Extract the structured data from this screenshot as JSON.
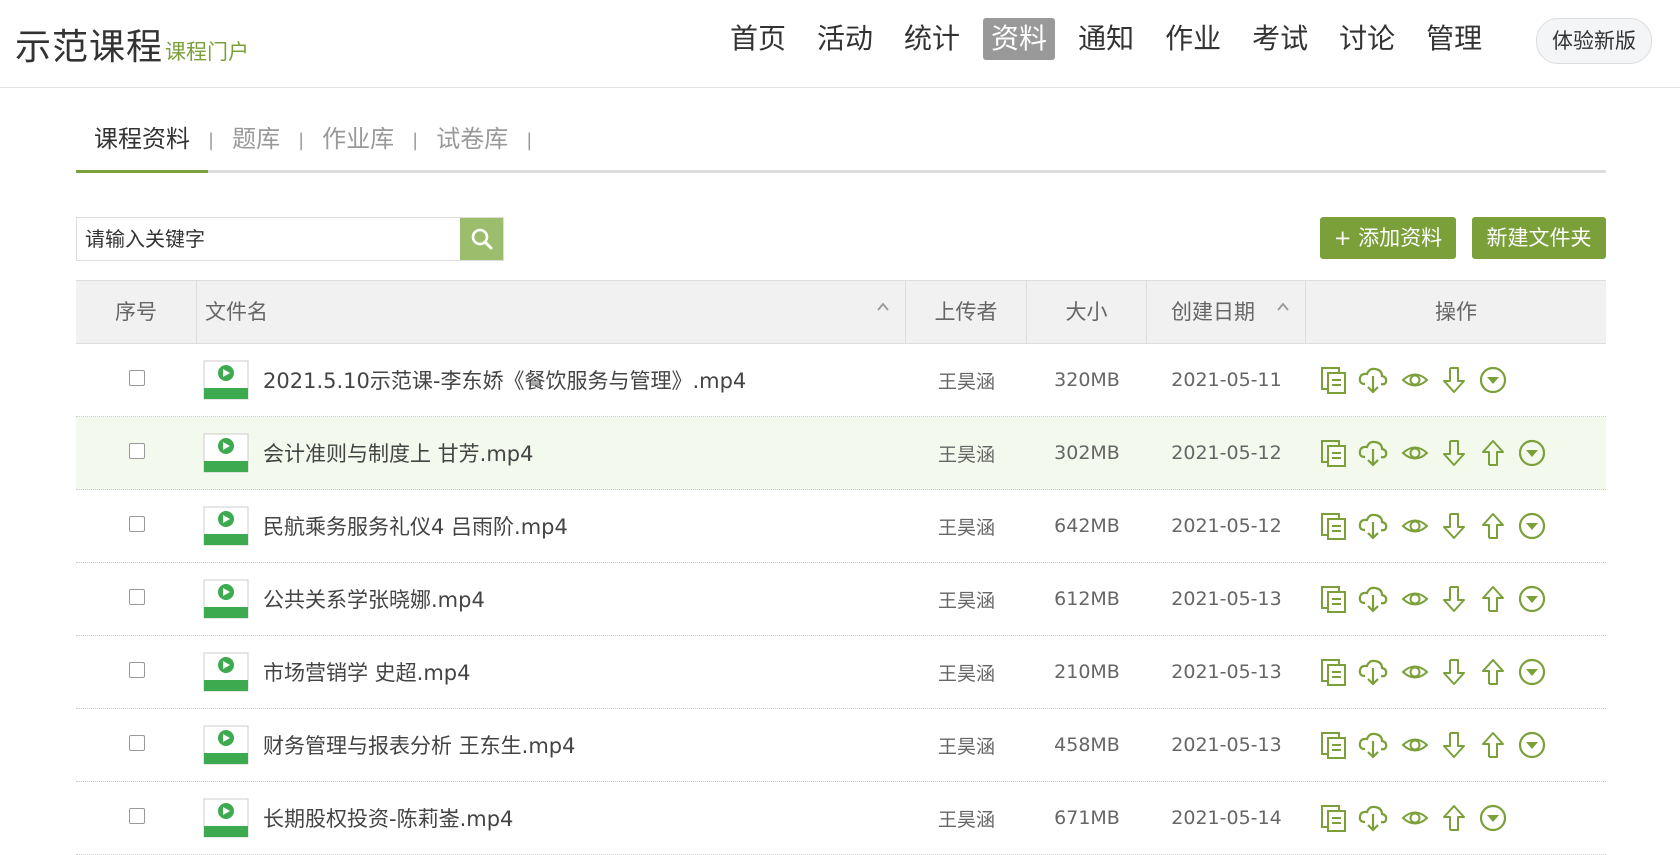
{
  "header": {
    "title": "示范课程",
    "subtitle": "课程门户",
    "nav": [
      "首页",
      "活动",
      "统计",
      "资料",
      "通知",
      "作业",
      "考试",
      "讨论",
      "管理"
    ],
    "active_nav": "资料",
    "try_new": "体验新版"
  },
  "subtabs": [
    "课程资料",
    "题库",
    "作业库",
    "试卷库"
  ],
  "search": {
    "placeholder": "请输入关键字"
  },
  "buttons": {
    "add": "+ 添加资料",
    "new_folder": "新建文件夹"
  },
  "table": {
    "headers": {
      "num": "序号",
      "name": "文件名",
      "uploader": "上传者",
      "size": "大小",
      "date": "创建日期",
      "ops": "操作"
    },
    "rows": [
      {
        "name": "2021.5.10示范课-李东娇《餐饮服务与管理》.mp4",
        "uploader": "王昊涵",
        "size": "320MB",
        "date": "2021-05-11",
        "ops": [
          "copy",
          "cloud",
          "view",
          "down",
          "menu"
        ]
      },
      {
        "name": "会计准则与制度上 甘芳.mp4",
        "uploader": "王昊涵",
        "size": "302MB",
        "date": "2021-05-12",
        "ops": [
          "copy",
          "cloud",
          "view",
          "down",
          "up",
          "menu"
        ]
      },
      {
        "name": "民航乘务服务礼仪4 吕雨阶.mp4",
        "uploader": "王昊涵",
        "size": "642MB",
        "date": "2021-05-12",
        "ops": [
          "copy",
          "cloud",
          "view",
          "down",
          "up",
          "menu"
        ]
      },
      {
        "name": "公共关系学张晓娜.mp4",
        "uploader": "王昊涵",
        "size": "612MB",
        "date": "2021-05-13",
        "ops": [
          "copy",
          "cloud",
          "view",
          "down",
          "up",
          "menu"
        ]
      },
      {
        "name": "市场营销学 史超.mp4",
        "uploader": "王昊涵",
        "size": "210MB",
        "date": "2021-05-13",
        "ops": [
          "copy",
          "cloud",
          "view",
          "down",
          "up",
          "menu"
        ]
      },
      {
        "name": "财务管理与报表分析 王东生.mp4",
        "uploader": "王昊涵",
        "size": "458MB",
        "date": "2021-05-13",
        "ops": [
          "copy",
          "cloud",
          "view",
          "down",
          "up",
          "menu"
        ]
      },
      {
        "name": "长期股权投资-陈莉崟.mp4",
        "uploader": "王昊涵",
        "size": "671MB",
        "date": "2021-05-14",
        "ops": [
          "copy",
          "cloud",
          "view",
          "up",
          "menu"
        ]
      }
    ],
    "highlight_row": 1
  },
  "colors": {
    "accent": "#7ba03a",
    "accent_light": "#9cbd6b",
    "row_highlight": "#f4f9ee"
  }
}
